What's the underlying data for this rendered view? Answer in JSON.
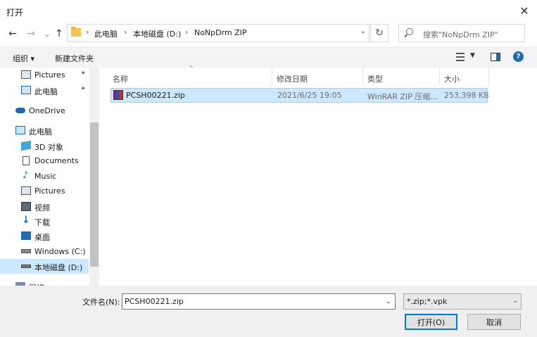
{
  "window": {
    "title": "打开",
    "close_glyph": "✕"
  },
  "nav": {
    "back_glyph": "←",
    "forward_glyph": "→",
    "recent_glyph": "⌄",
    "up_glyph": "↑",
    "breadcrumbs": [
      "此电脑",
      "本地磁盘 (D:)",
      "NoNpDrm ZIP"
    ],
    "crumb_separator": "›",
    "refresh_glyph": "↻",
    "search_placeholder": "搜索\"NoNpDrm ZIP\""
  },
  "toolbar": {
    "organize_label": "组织 ▾",
    "new_folder_label": "新建文件夹",
    "help_glyph": "?"
  },
  "sidebar": {
    "items": [
      {
        "label": "Pictures",
        "icon": "pictures-icon",
        "pinned": true
      },
      {
        "label": "此电脑",
        "icon": "this-pc-icon",
        "pinned": true
      },
      {
        "label": "OneDrive",
        "icon": "onedrive-icon",
        "pinned": false
      },
      {
        "label": "此电脑",
        "icon": "this-pc-icon",
        "pinned": false
      },
      {
        "label": "3D 对象",
        "icon": "3d-objects-icon",
        "pinned": false
      },
      {
        "label": "Documents",
        "icon": "documents-icon",
        "pinned": false
      },
      {
        "label": "Music",
        "icon": "music-icon",
        "pinned": false
      },
      {
        "label": "Pictures",
        "icon": "pictures-icon",
        "pinned": false
      },
      {
        "label": "视频",
        "icon": "videos-icon",
        "pinned": false
      },
      {
        "label": "下载",
        "icon": "downloads-icon",
        "pinned": false
      },
      {
        "label": "桌面",
        "icon": "desktop-icon",
        "pinned": false
      },
      {
        "label": "Windows (C:)",
        "icon": "drive-icon",
        "pinned": false
      },
      {
        "label": "本地磁盘 (D:)",
        "icon": "drive-icon",
        "pinned": false,
        "selected": true
      },
      {
        "label": "网络",
        "icon": "network-icon",
        "pinned": false
      }
    ],
    "pin_glyph": "📌"
  },
  "file_list": {
    "columns": [
      "名称",
      "修改日期",
      "类型",
      "大小"
    ],
    "sort_glyph": "^",
    "rows": [
      {
        "name": "PCSH00221.zip",
        "modified": "2021/6/25 19:05",
        "type": "WinRAR ZIP 压缩...",
        "size": "253,398 KB",
        "icon": "winrar-zip-icon"
      }
    ]
  },
  "bottom": {
    "filename_label": "文件名(N):",
    "filename_value": "PCSH00221.zip",
    "filter_value": "*.zip;*.vpk",
    "open_label": "打开(O)",
    "cancel_label": "取消"
  },
  "colors": {
    "selection": "#cce8ff",
    "accent": "#0078d7",
    "toolbar_bg": "#f3f3f3"
  }
}
